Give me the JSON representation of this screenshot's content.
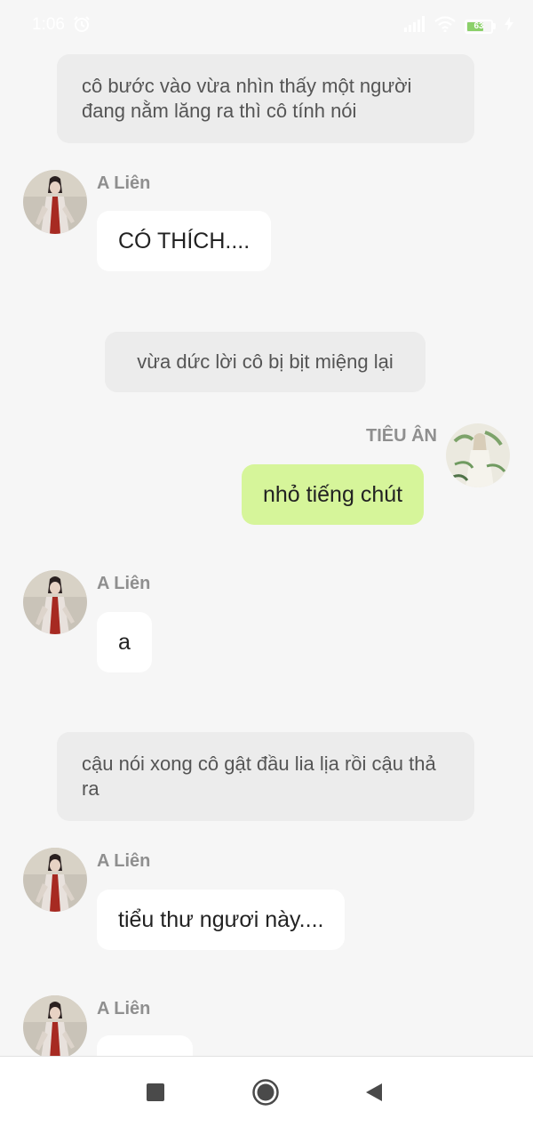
{
  "status_bar": {
    "time": "1:06",
    "battery_level": "63",
    "icons": [
      "alarm-icon",
      "signal-icon",
      "wifi-icon",
      "battery-icon",
      "charging-icon"
    ]
  },
  "messages": [
    {
      "type": "narration",
      "text": "cô bước vào vừa nhìn thấy một người đang nằm lăng ra thì cô tính nói"
    },
    {
      "type": "chat",
      "sender": "A Liên",
      "text": "CÓ THÍCH...."
    },
    {
      "type": "narration",
      "text": "vừa dức lời cô bị bịt miệng lại"
    },
    {
      "type": "chat_me",
      "sender": "TIÊU ÂN",
      "text": "nhỏ tiếng chút"
    },
    {
      "type": "chat",
      "sender": "A Liên",
      "text": "a"
    },
    {
      "type": "narration",
      "text": "cậu nói xong cô gật đầu lia lịa rồi cậu thả ra"
    },
    {
      "type": "chat",
      "sender": "A Liên",
      "text": "tiểu thư ngươi này...."
    },
    {
      "type": "chat",
      "sender": "A Liên",
      "text": ""
    }
  ],
  "nav_bar": {
    "buttons": [
      "recent-apps-button",
      "home-button",
      "back-button"
    ]
  },
  "colors": {
    "background": "#f6f6f6",
    "narration_bg": "#ececec",
    "bubble_bg": "#ffffff",
    "my_bubble_bg": "#d6f59a",
    "sender_text": "#8f8f8f"
  }
}
